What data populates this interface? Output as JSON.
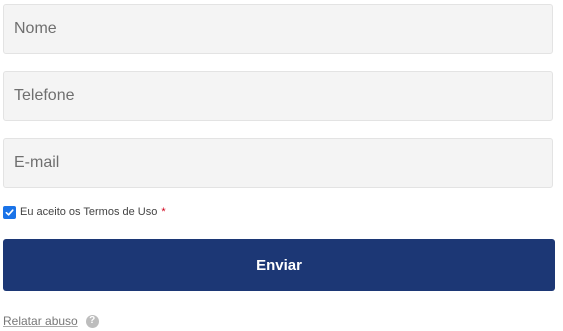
{
  "form": {
    "name_placeholder": "Nome",
    "phone_placeholder": "Telefone",
    "email_placeholder": "E-mail",
    "terms": {
      "checked": true,
      "label": "Eu aceito os Termos de Uso",
      "required_mark": "*"
    },
    "submit_label": "Enviar"
  },
  "footer": {
    "report_link": "Relatar abuso",
    "help_icon": "question-circle-icon",
    "help_glyph": "?"
  },
  "colors": {
    "field_bg": "#f4f4f4",
    "button_bg": "#1c3775",
    "checkbox": "#1a73e8",
    "required": "#d0021b"
  }
}
